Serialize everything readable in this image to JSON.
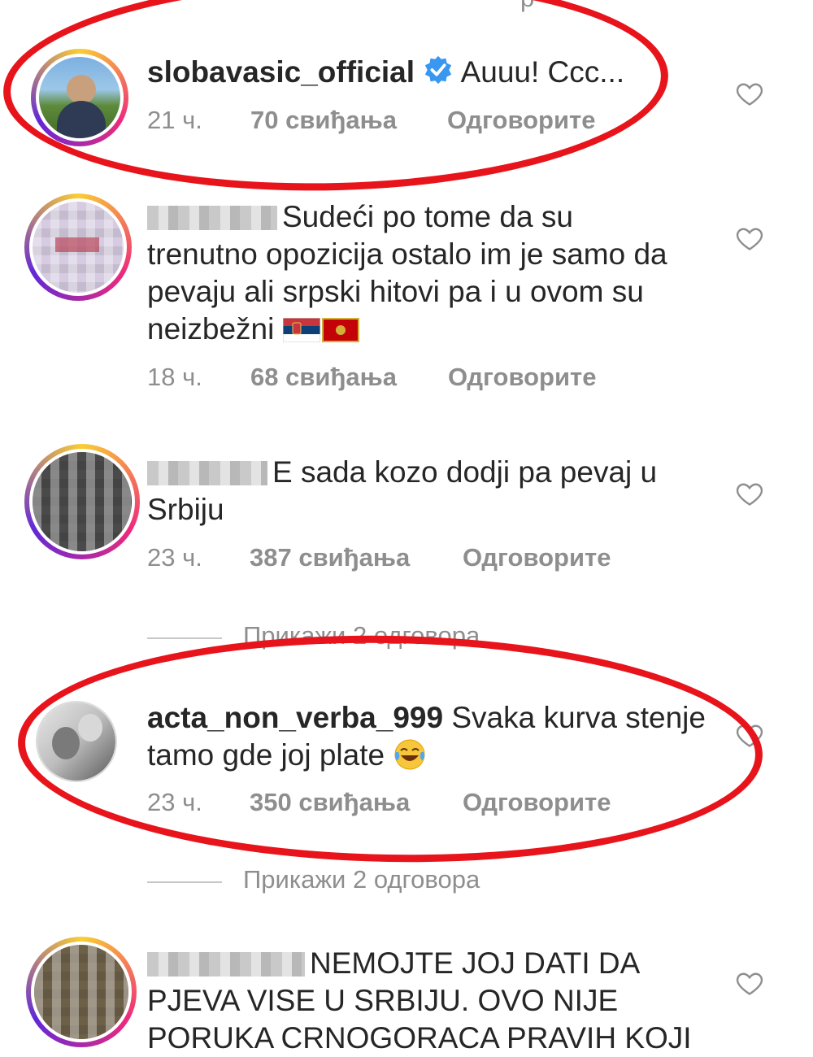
{
  "comments": [
    {
      "username": "slobavasic_official",
      "verified": true,
      "text": "Auuu! Ccc...",
      "time": "21 ч.",
      "likes": "70 свиђања",
      "reply": "Одговорите",
      "highlighted": true
    },
    {
      "username": "",
      "text": "Sudeći po tome da su trenutno opozicija ostalo im je samo da pevaju ali srpski hitovi pa i u ovom su neizbežni",
      "text_lines": [
        "Sudeći po tome da su",
        "trenutno opozicija ostalo im je samo da",
        "pevaju ali srpski hitovi pa i u ovom su",
        "neizbežni"
      ],
      "emojis": [
        "serbia-flag",
        "montenegro-flag"
      ],
      "time": "18 ч.",
      "likes": "68 свиђања",
      "reply": "Одговорите"
    },
    {
      "username": "",
      "text_lines": [
        "E sada kozo dodji pa pevaj u",
        "Srbiju"
      ],
      "time": "23 ч.",
      "likes": "387 свиђања",
      "reply": "Одговорите",
      "view_replies": "Прикажи 2 одговора"
    },
    {
      "username": "acta_non_verba_999",
      "text_lines": [
        "Svaka kurva stenje",
        "tamo gde joj plate"
      ],
      "emojis": [
        "tears-of-joy"
      ],
      "time": "23 ч.",
      "likes": "350 свиђања",
      "reply": "Одговорите",
      "view_replies": "Прикажи 2 одговора",
      "highlighted": true
    },
    {
      "username": "",
      "text_lines": [
        "NEMOJTE JOJ DATI DA",
        "PJEVA VISE U SRBIJU. OVO NIJE",
        "PORUKA CRNOGORACA PRAVIH KOJI"
      ]
    }
  ],
  "top_partial_text": "р",
  "colors": {
    "highlight": "#e8141b",
    "muted": "#8e8e8e",
    "verified": "#3897f0"
  }
}
